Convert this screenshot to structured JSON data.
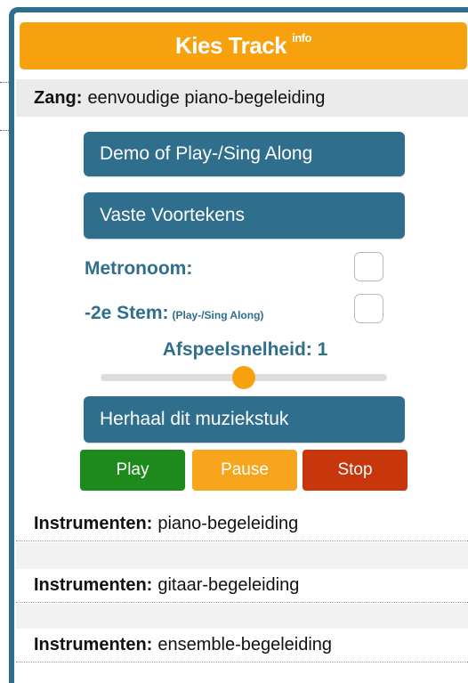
{
  "header": {
    "title": "Kies Track",
    "info_label": "info"
  },
  "zang": {
    "label": "Zang:",
    "value": "eenvoudige piano-begeleiding"
  },
  "buttons": {
    "demo": "Demo of Play-/Sing Along",
    "vaste": "Vaste Voortekens",
    "herhaal": "Herhaal dit muziekstuk"
  },
  "options": {
    "metronoom_label": "Metronoom:",
    "metronoom_checked": false,
    "stem_label": "-2e Stem:",
    "stem_note": "(Play-/Sing Along)",
    "stem_checked": false
  },
  "speed": {
    "label": "Afspeelsnelheid: 1",
    "value": 1,
    "min": 0.5,
    "max": 1.5
  },
  "controls": {
    "play": "Play",
    "pause": "Pause",
    "stop": "Stop",
    "play_color": "#1e8a1e",
    "pause_color": "#f7a51c",
    "stop_color": "#c8370c"
  },
  "instrumenten": [
    {
      "label": "Instrumenten:",
      "value": "piano-begeleiding"
    },
    {
      "label": "Instrumenten:",
      "value": "gitaar-begeleiding"
    },
    {
      "label": "Instrumenten:",
      "value": "ensemble-begeleiding"
    }
  ],
  "colors": {
    "accent": "#f7a10e",
    "primary": "#2f6e8c"
  }
}
